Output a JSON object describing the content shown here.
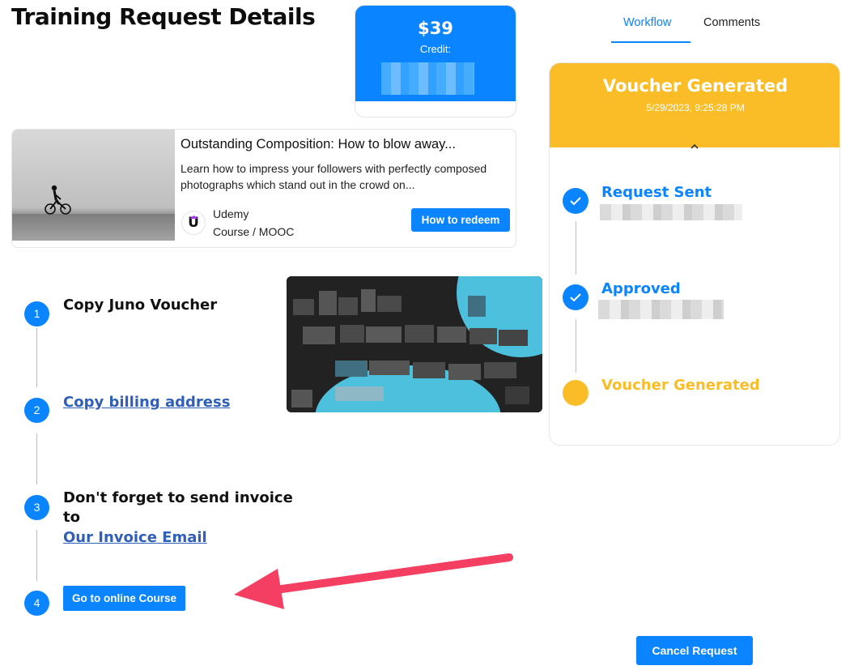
{
  "header": {
    "title": "Training Request Details"
  },
  "credit": {
    "amount": "$39",
    "label": "Credit:"
  },
  "course": {
    "title": "Outstanding Composition: How to blow away...",
    "description": "Learn how to impress your followers with perfectly composed photographs which stand out in the crowd on...",
    "provider": "Udemy",
    "provider_logo_letter": "U",
    "type": "Course / MOOC",
    "redeem_label": "How to redeem"
  },
  "steps": [
    {
      "number": "1",
      "text": "Copy Juno Voucher"
    },
    {
      "number": "2",
      "link": "Copy billing address"
    },
    {
      "number": "3",
      "text_line1": "Don't forget to send invoice",
      "text_line2": "to",
      "link": "Our Invoice Email"
    },
    {
      "number": "4",
      "button_label": "Go to online Course"
    }
  ],
  "tabs": [
    {
      "label": "Workflow",
      "active": true
    },
    {
      "label": "Comments",
      "active": false
    }
  ],
  "workflow": {
    "status": "Voucher Generated",
    "date": "5/29/2023, 9:25:28 PM",
    "items": [
      {
        "label": "Request Sent",
        "state": "done",
        "icon": "check-icon"
      },
      {
        "label": "Approved",
        "state": "done",
        "icon": "check-icon"
      },
      {
        "label": "Voucher Generated",
        "state": "current",
        "icon": "circle-icon"
      }
    ]
  },
  "cancel_label": "Cancel Request",
  "colors": {
    "accent": "#0a84ff",
    "warning": "#fbbd27",
    "link": "#2f5fb8",
    "arrow": "#f43f63"
  }
}
